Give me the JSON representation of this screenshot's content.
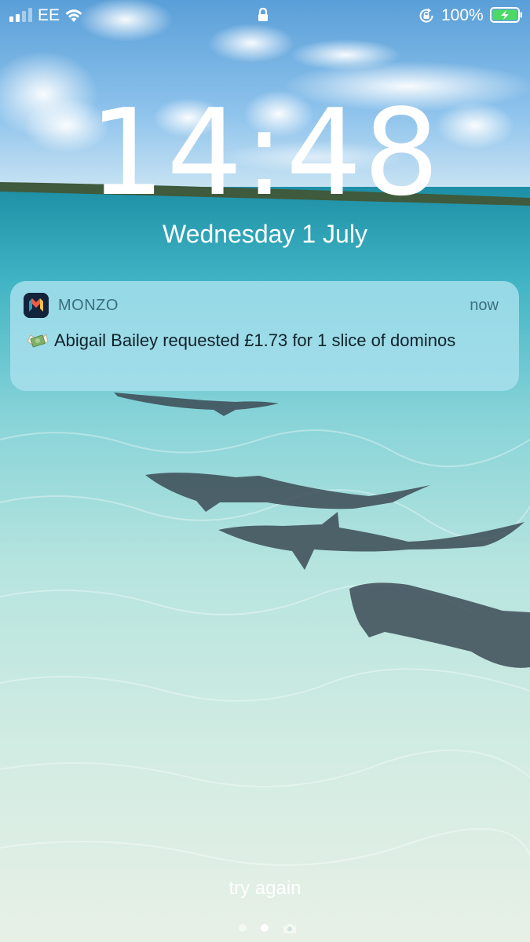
{
  "status_bar": {
    "carrier": "EE",
    "signal_bars": 4,
    "signal_bars_filled": 2,
    "battery_percent": "100%",
    "icons": [
      "signal-icon",
      "wifi-icon",
      "lock-icon",
      "rotation-lock-icon",
      "battery-charging-icon"
    ]
  },
  "lock_screen": {
    "time": "14:48",
    "date": "Wednesday 1 July"
  },
  "notification": {
    "app_name": "MONZO",
    "time": "now",
    "emoji": "money-with-wings-icon",
    "message": "Abigail Bailey requested £1.73 for 1 slice of dominos"
  },
  "bottom": {
    "try_again_label": "try again",
    "pages": [
      "dot",
      "dot-active",
      "camera-icon"
    ]
  },
  "colors": {
    "notification_bg": "#aae1ee",
    "app_icon_bg": "#14233c",
    "monzo_red": "#f15b4b",
    "monzo_yellow": "#f7c34a",
    "monzo_teal": "#2e9fb1",
    "battery_green": "#4cd964"
  }
}
